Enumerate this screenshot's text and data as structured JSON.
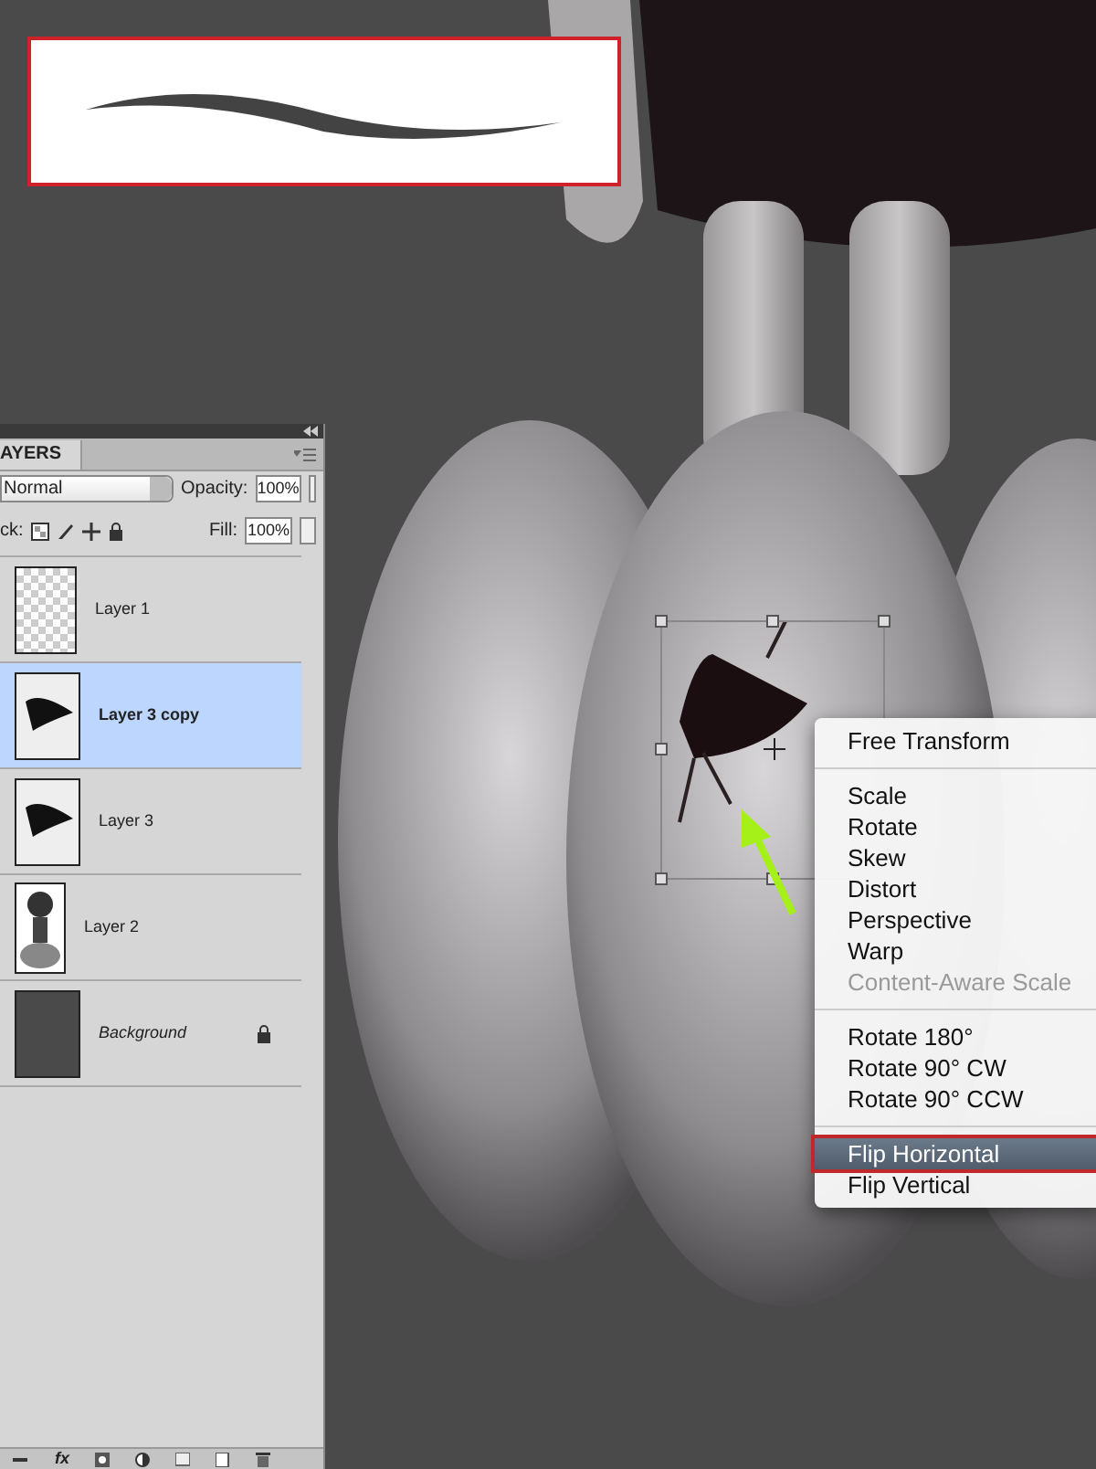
{
  "layers_panel": {
    "tab": "AYERS",
    "blend_mode": "Normal",
    "opacity_label": "Opacity:",
    "opacity": "100%",
    "lock_label": "ck:",
    "fill_label": "Fill:",
    "fill": "100%",
    "layers": [
      {
        "name": "Layer 1",
        "kind": "empty",
        "selected": false,
        "locked": false
      },
      {
        "name": "Layer 3 copy",
        "kind": "shape",
        "selected": true,
        "locked": false
      },
      {
        "name": "Layer 3",
        "kind": "shape",
        "selected": false,
        "locked": false
      },
      {
        "name": "Layer 2",
        "kind": "figure",
        "selected": false,
        "locked": false
      },
      {
        "name": "Background",
        "kind": "background",
        "selected": false,
        "locked": true
      }
    ],
    "toolbar_effects": "fx"
  },
  "context_menu": {
    "groups": [
      [
        {
          "label": "Free Transform",
          "disabled": false,
          "selected": false
        }
      ],
      [
        {
          "label": "Scale",
          "disabled": false,
          "selected": false
        },
        {
          "label": "Rotate",
          "disabled": false,
          "selected": false
        },
        {
          "label": "Skew",
          "disabled": false,
          "selected": false
        },
        {
          "label": "Distort",
          "disabled": false,
          "selected": false
        },
        {
          "label": "Perspective",
          "disabled": false,
          "selected": false
        },
        {
          "label": "Warp",
          "disabled": false,
          "selected": false
        },
        {
          "label": "Content-Aware Scale",
          "disabled": true,
          "selected": false
        }
      ],
      [
        {
          "label": "Rotate 180°",
          "disabled": false,
          "selected": false
        },
        {
          "label": "Rotate 90° CW",
          "disabled": false,
          "selected": false
        },
        {
          "label": "Rotate 90° CCW",
          "disabled": false,
          "selected": false
        }
      ],
      [
        {
          "label": "Flip Horizontal",
          "disabled": false,
          "selected": true
        },
        {
          "label": "Flip Vertical",
          "disabled": false,
          "selected": false
        }
      ]
    ]
  }
}
